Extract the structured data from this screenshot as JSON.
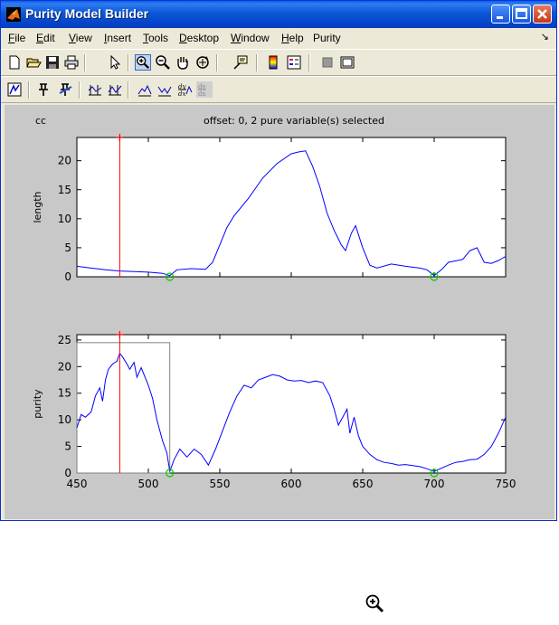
{
  "window": {
    "title": "Purity Model Builder"
  },
  "menu": [
    "File",
    "Edit",
    "View",
    "Insert",
    "Tools",
    "Desktop",
    "Window",
    "Help",
    "Purity"
  ],
  "menu_mnemonic": [
    "F",
    "E",
    "V",
    "I",
    "T",
    "D",
    "W",
    "H",
    ""
  ],
  "menu_rest": [
    "ile",
    "dit",
    "iew",
    "nsert",
    "ools",
    "esktop",
    "indow",
    "elp",
    "Purity"
  ],
  "menu_arrow": "↘",
  "toolbar1": [
    "new-file",
    "open-folder",
    "save",
    "print",
    "pointer",
    "zoom-in",
    "zoom-out",
    "pan-hand",
    "rotate-3d",
    "data-cursor",
    "colorbar",
    "legend",
    "hide-plot-tools",
    "show-plot-tools"
  ],
  "toolbar2": [
    "purity-model",
    "pin-variable",
    "unpin-variable",
    "derivative-1",
    "derivative-2",
    "peak-1",
    "peak-2",
    "dydx-1",
    "dydx-2"
  ],
  "figure": {
    "corner_label": "cc",
    "title": "offset: 0, 2 pure variable(s) selected"
  },
  "chart_data": [
    {
      "type": "line",
      "ylabel": "length",
      "xlim": [
        450,
        750
      ],
      "ylim": [
        0,
        24
      ],
      "yticks": [
        "0",
        "5",
        "10",
        "15",
        "20"
      ],
      "xticks": [],
      "series": [
        {
          "color": "#0000ff",
          "x": [
            450,
            460,
            470,
            480,
            490,
            500,
            510,
            515,
            520,
            530,
            540,
            545,
            550,
            555,
            560,
            570,
            580,
            590,
            600,
            605,
            610,
            615,
            620,
            625,
            630,
            635,
            638,
            642,
            645,
            650,
            655,
            660,
            670,
            680,
            690,
            695,
            700,
            705,
            710,
            720,
            725,
            730,
            735,
            740,
            745,
            750
          ],
          "y": [
            1.8,
            1.5,
            1.2,
            1.0,
            0.9,
            0.8,
            0.6,
            0.2,
            1.2,
            1.4,
            1.3,
            2.5,
            5.5,
            8.5,
            10.5,
            13.5,
            17.0,
            19.5,
            21.2,
            21.5,
            21.7,
            19.0,
            15.5,
            11.0,
            8.0,
            5.5,
            4.5,
            7.5,
            8.8,
            5.0,
            2.0,
            1.5,
            2.2,
            1.8,
            1.5,
            1.2,
            0.2,
            1.2,
            2.5,
            3.0,
            4.5,
            5.0,
            2.5,
            2.3,
            2.8,
            3.5
          ]
        }
      ],
      "markers": [
        {
          "x": 480,
          "type": "selected-pure-variable",
          "color": "#ff0000"
        },
        {
          "x": 515,
          "type": "circle",
          "color": "#00cc00"
        },
        {
          "x": 700,
          "type": "circle",
          "color": "#00cc00"
        }
      ]
    },
    {
      "type": "line",
      "ylabel": "purity",
      "xlim": [
        450,
        750
      ],
      "ylim": [
        0,
        26
      ],
      "yticks": [
        "0",
        "5",
        "10",
        "15",
        "20",
        "25"
      ],
      "xticks": [
        "450",
        "500",
        "550",
        "600",
        "650",
        "700",
        "750"
      ],
      "series": [
        {
          "color": "#0000ff",
          "x": [
            450,
            453,
            456,
            460,
            463,
            466,
            468,
            470,
            472,
            475,
            478,
            480,
            482,
            485,
            487,
            490,
            492,
            495,
            500,
            503,
            506,
            510,
            513,
            515,
            518,
            522,
            527,
            532,
            537,
            542,
            547,
            552,
            557,
            562,
            567,
            572,
            577,
            582,
            587,
            592,
            597,
            602,
            607,
            612,
            617,
            622,
            627,
            630,
            633,
            636,
            639,
            641,
            644,
            647,
            650,
            655,
            660,
            665,
            670,
            675,
            680,
            685,
            690,
            695,
            700,
            705,
            710,
            715,
            720,
            725,
            730,
            735,
            740,
            745,
            750
          ],
          "y": [
            8.5,
            11.0,
            10.5,
            11.5,
            14.5,
            16.0,
            13.5,
            17.5,
            19.5,
            20.5,
            21.0,
            22.5,
            21.8,
            20.5,
            19.5,
            20.8,
            18.0,
            19.8,
            16.5,
            14.0,
            10.0,
            6.0,
            3.8,
            0.3,
            2.5,
            4.5,
            3.0,
            4.5,
            3.5,
            1.5,
            4.5,
            8.0,
            11.5,
            14.5,
            16.5,
            16.0,
            17.5,
            18.0,
            18.5,
            18.2,
            17.5,
            17.3,
            17.4,
            17.0,
            17.3,
            17.0,
            14.5,
            12.0,
            9.0,
            10.5,
            12.0,
            7.5,
            10.5,
            7.0,
            5.0,
            3.5,
            2.5,
            2.0,
            1.8,
            1.5,
            1.6,
            1.4,
            1.2,
            0.8,
            0.3,
            0.9,
            1.5,
            2.0,
            2.2,
            2.5,
            2.6,
            3.5,
            5.0,
            7.5,
            10.5
          ]
        }
      ],
      "markers": [
        {
          "x": 480,
          "type": "selected-pure-variable",
          "color": "#ff0000"
        },
        {
          "x": 515,
          "type": "circle",
          "color": "#00cc00"
        },
        {
          "x": 700,
          "type": "circle",
          "color": "#00cc00"
        }
      ],
      "selection_box": {
        "x0": 450,
        "x1": 515,
        "y0": 0,
        "y1": 24.5
      }
    }
  ],
  "footer_icon": "zoom-in-icon"
}
